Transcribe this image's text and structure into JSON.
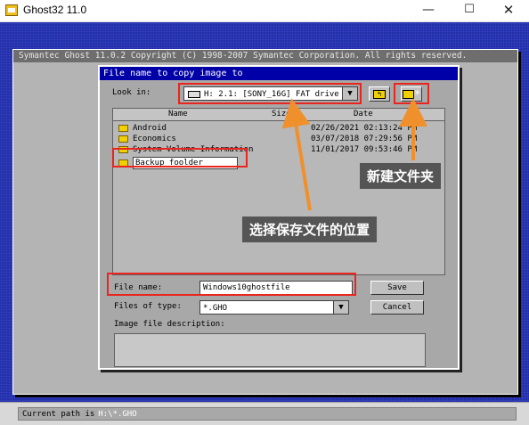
{
  "window": {
    "title": "Ghost32 11.0",
    "minimize_glyph": "—",
    "maximize_glyph": "☐",
    "close_glyph": "✕"
  },
  "ghost": {
    "header_text": "Symantec Ghost 11.0.2   Copyright (C) 1998-2007 Symantec Corporation. All rights reserved."
  },
  "dialog": {
    "title": "File name to copy image to",
    "look_in_label": "Look in:",
    "look_in_value": "H: 2.1: [SONY_16G] FAT drive",
    "up_button_glyph": "↰",
    "new_folder_glyph": "✳",
    "columns": {
      "name": "Name",
      "size": "Size",
      "date": "Date"
    },
    "files": [
      {
        "name": "Android",
        "date": "02/26/2021 02:13:24 PM"
      },
      {
        "name": "Economics",
        "date": "03/07/2018 07:29:56 PM"
      },
      {
        "name": "System Volume Information",
        "date": "11/01/2017 09:53:46 PM"
      },
      {
        "name": "Backup foolder",
        "date": ""
      }
    ],
    "file_name_label": "File name:",
    "file_name_value": "Windows10ghostfile",
    "files_of_type_label": "Files of type:",
    "files_of_type_value": "*.GHO",
    "image_desc_label": "Image file description:",
    "save_label": "Save",
    "cancel_label": "Cancel"
  },
  "annotations": {
    "new_folder": "新建文件夹",
    "choose_location": "选择保存文件的位置"
  },
  "status": {
    "label": "Current path is",
    "value": "H:\\*.GHO"
  },
  "colors": {
    "ghost_blue": "#2230a8",
    "dialog_title_blue": "#0000a8",
    "highlight_red": "#e8251e",
    "arrow_orange": "#f0902c"
  }
}
